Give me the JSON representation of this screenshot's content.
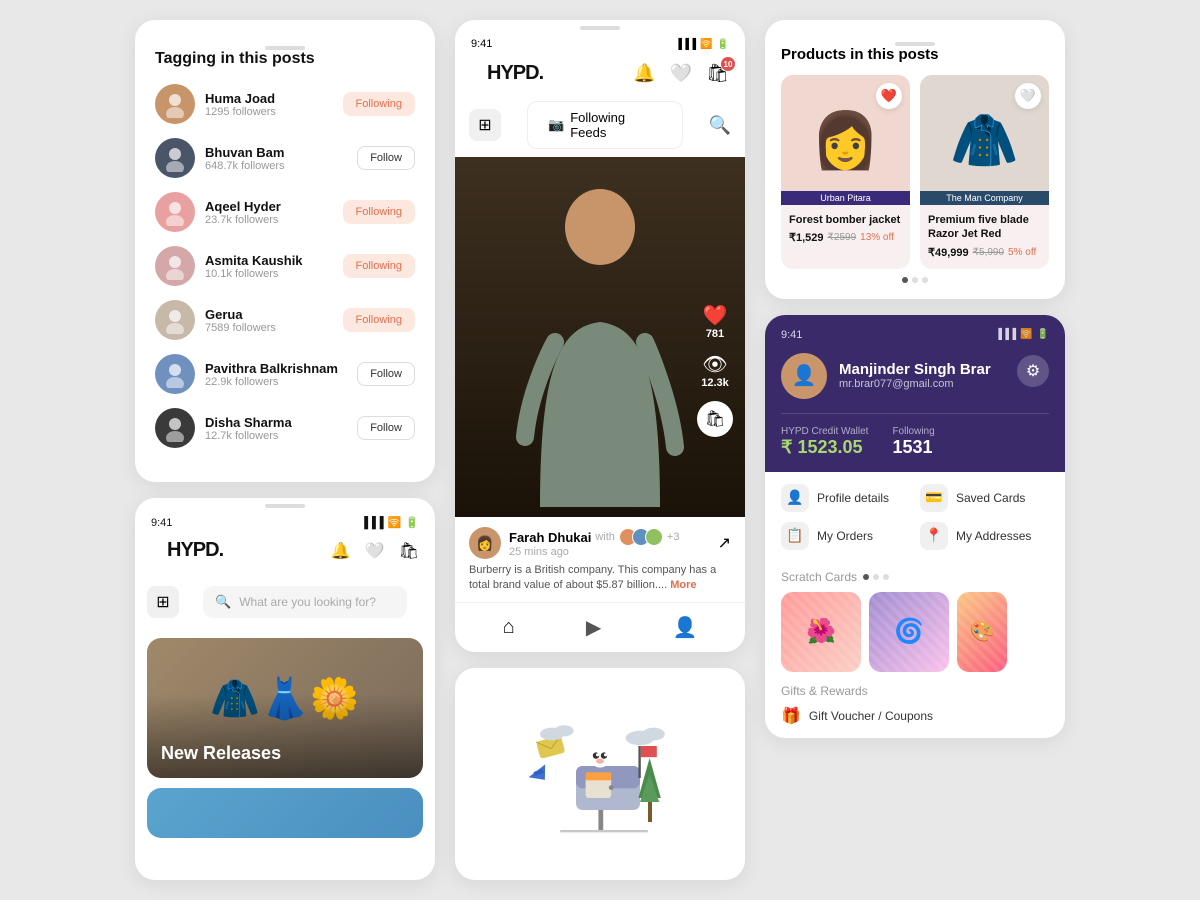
{
  "tagging": {
    "title": "Tagging in this posts",
    "users": [
      {
        "name": "Huma Joad",
        "followers": "1295 followers",
        "following": true,
        "avatar": "👤"
      },
      {
        "name": "Bhuvan Bam",
        "followers": "648.7k followers",
        "following": false,
        "avatar": "👤"
      },
      {
        "name": "Aqeel Hyder",
        "followers": "23.7k followers",
        "following": true,
        "avatar": "👤"
      },
      {
        "name": "Asmita Kaushik",
        "followers": "10.1k followers",
        "following": true,
        "avatar": "👤"
      },
      {
        "name": "Gerua",
        "followers": "7589 followers",
        "following": true,
        "avatar": "👤"
      },
      {
        "name": "Pavithra Balkrishnam",
        "followers": "22.9k followers",
        "following": false,
        "avatar": "👤"
      },
      {
        "name": "Disha Sharma",
        "followers": "12.7k followers",
        "following": false,
        "avatar": "👤"
      }
    ],
    "follow_label": "Follow",
    "following_label": "Following"
  },
  "phone_left": {
    "time": "9:41",
    "app_name": "HYPD.",
    "search_placeholder": "What are you looking for?",
    "new_releases": "New Releases"
  },
  "phone_center": {
    "time": "9:41",
    "app_name": "HYPD.",
    "following_feeds": "Following Feeds",
    "post": {
      "username": "Farah Dhukai",
      "time_ago": "25 mins ago",
      "collab_count": "+3",
      "likes": "781",
      "views": "12.3k",
      "description": "Burberry is a British company. This company has a total brand value of about $5.87 billion....",
      "more": "More"
    }
  },
  "products_card": {
    "title": "Products in this posts",
    "products": [
      {
        "brand": "Urban Pitara",
        "name": "Forest bomber jacket",
        "price_current": "₹1,529",
        "price_old": "₹2599",
        "discount": "13% off",
        "liked": true,
        "emoji": "👗"
      },
      {
        "brand": "The Man Company",
        "name": "Premium five blade Razor Jet Red",
        "price_current": "₹49,999",
        "price_old": "₹5,990",
        "discount": "5% off",
        "liked": false,
        "emoji": "🧥"
      }
    ]
  },
  "profile_card": {
    "time": "9:41",
    "user": {
      "name": "Manjinder Singh Brar",
      "email": "mr.brar077@gmail.com",
      "avatar": "👤"
    },
    "wallet_label": "HYPD Credit Wallet",
    "wallet_value": "₹ 1523.05",
    "following_label": "Following",
    "following_value": "1531",
    "menu": [
      {
        "icon": "👤",
        "label": "Profile details"
      },
      {
        "icon": "💳",
        "label": "Saved Cards"
      },
      {
        "icon": "📋",
        "label": "My Orders"
      },
      {
        "icon": "📍",
        "label": "My Addresses"
      }
    ],
    "scratch_title": "Scratch Cards",
    "gifts_title": "Gifts & Rewards",
    "gift_item": "Gift Voucher / Coupons"
  }
}
